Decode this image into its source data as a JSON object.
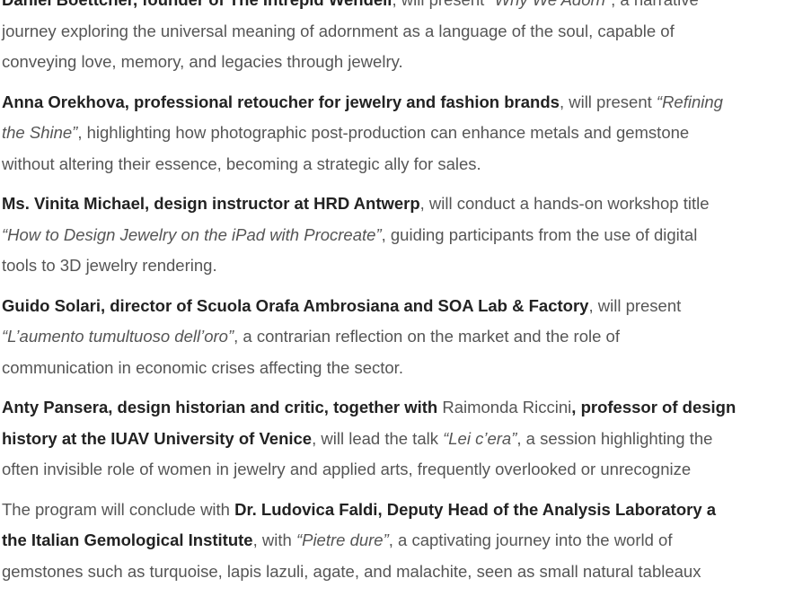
{
  "paragraphs": [
    {
      "lines": [
        [
          {
            "t": "Daniel Boettcher, founder of The Intrepid Wendell",
            "s": "b"
          },
          {
            "t": ", will present ",
            "s": "n"
          },
          {
            "t": "“Why We Adorn”",
            "s": "i"
          },
          {
            "t": ", a narrative",
            "s": "n"
          }
        ],
        [
          {
            "t": "journey exploring the universal meaning of adornment as a language of the soul, capable of",
            "s": "n"
          }
        ],
        [
          {
            "t": "conveying love, memory, and legacies through jewelry.",
            "s": "n"
          }
        ]
      ]
    },
    {
      "lines": [
        [
          {
            "t": "Anna Orekhova, professional retoucher for jewelry and fashion brands",
            "s": "b"
          },
          {
            "t": ", will present ",
            "s": "n"
          },
          {
            "t": "“Refining",
            "s": "i"
          }
        ],
        [
          {
            "t": "the Shine”",
            "s": "i"
          },
          {
            "t": ", highlighting how photographic post-production can enhance metals and gemstone",
            "s": "n"
          }
        ],
        [
          {
            "t": "without altering their essence, becoming a strategic ally for sales.",
            "s": "n"
          }
        ]
      ]
    },
    {
      "lines": [
        [
          {
            "t": "Ms. Vinita Michael, design instructor at HRD Antwerp",
            "s": "b"
          },
          {
            "t": ", will conduct a hands-on workshop title",
            "s": "n"
          }
        ],
        [
          {
            "t": "“How to Design Jewelry on the iPad with Procreate”",
            "s": "i"
          },
          {
            "t": ", guiding participants from the use of digital",
            "s": "n"
          }
        ],
        [
          {
            "t": "tools to 3D jewelry rendering.",
            "s": "n"
          }
        ]
      ]
    },
    {
      "lines": [
        [
          {
            "t": "Guido Solari, director of Scuola Orafa Ambrosiana and SOA Lab & Factory",
            "s": "b"
          },
          {
            "t": ", will present",
            "s": "n"
          }
        ],
        [
          {
            "t": "“L’aumento tumultuoso dell’oro”",
            "s": "i"
          },
          {
            "t": ", a contrarian reflection on the market and the role of",
            "s": "n"
          }
        ],
        [
          {
            "t": "communication in economic crises affecting the sector.",
            "s": "n"
          }
        ]
      ]
    },
    {
      "lines": [
        [
          {
            "t": "Anty Pansera, design historian and critic, together with",
            "s": "b"
          },
          {
            "t": " Raimonda Riccini",
            "s": "n"
          },
          {
            "t": ", professor of design",
            "s": "b"
          }
        ],
        [
          {
            "t": "history at the IUAV University of Venice",
            "s": "b"
          },
          {
            "t": ", will lead the talk ",
            "s": "n"
          },
          {
            "t": "“Lei c’era”",
            "s": "i"
          },
          {
            "t": ", a session highlighting the",
            "s": "n"
          }
        ],
        [
          {
            "t": "often invisible role of women in jewelry and applied arts, frequently overlooked or unrecognize",
            "s": "n"
          }
        ]
      ]
    },
    {
      "lines": [
        [
          {
            "t": "The program will conclude with ",
            "s": "n"
          },
          {
            "t": "Dr. Ludovica Faldi, Deputy Head of the Analysis Laboratory a",
            "s": "b"
          }
        ],
        [
          {
            "t": "the Italian Gemological Institute",
            "s": "b"
          },
          {
            "t": ", with ",
            "s": "n"
          },
          {
            "t": "“Pietre dure”",
            "s": "i"
          },
          {
            "t": ", a captivating journey into the world of",
            "s": "n"
          }
        ],
        [
          {
            "t": "gemstones such as turquoise, lapis lazuli, agate, and malachite, seen as small natural tableaux",
            "s": "n"
          }
        ]
      ]
    }
  ]
}
